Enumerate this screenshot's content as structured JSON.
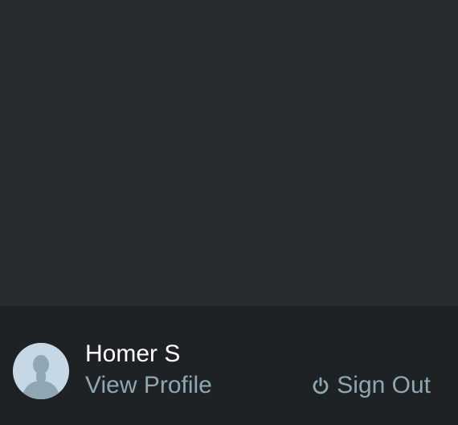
{
  "footer": {
    "user_name": "Homer S",
    "view_profile_label": "View Profile",
    "sign_out_label": "Sign Out",
    "avatar_icon": "user-silhouette-icon",
    "sign_out_icon": "power-icon"
  },
  "colors": {
    "background": "#272c30",
    "footer_background": "#1f2225",
    "user_name": "#ffffff",
    "link": "#8ea7b2",
    "avatar_background": "#c6d8e5",
    "avatar_silhouette": "#8fa6b3"
  }
}
